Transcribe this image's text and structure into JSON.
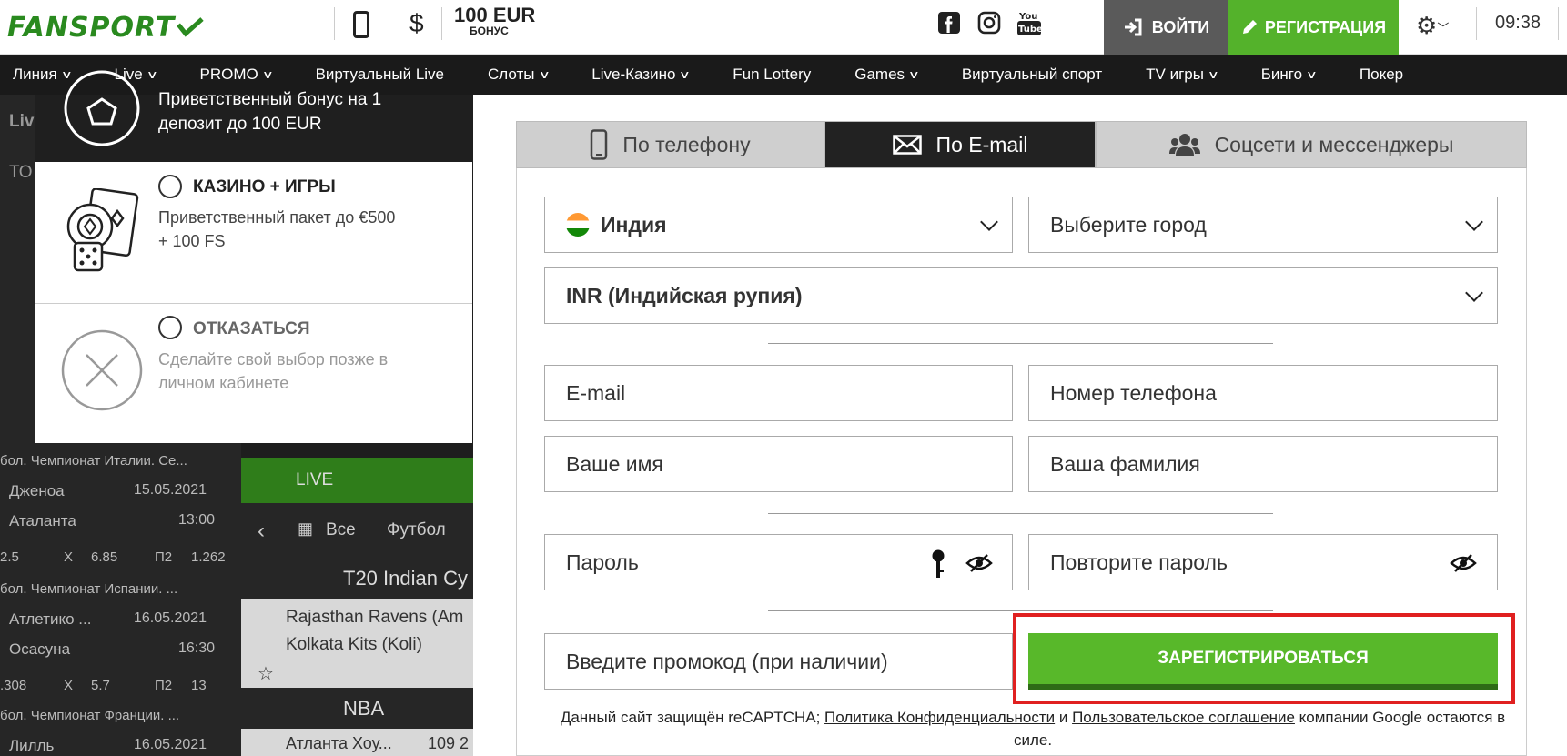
{
  "header": {
    "logo_main": "FANSPORT",
    "bonus_amount": "100 EUR",
    "bonus_label": "БОНУС",
    "login_label": "ВОЙТИ",
    "register_label": "РЕГИСТРАЦИЯ",
    "time": "09:38"
  },
  "nav": [
    "Линия",
    "Live",
    "PROMO",
    "Виртуальный Live",
    "Слоты",
    "Live-Казино",
    "Fun Lottery",
    "Games",
    "Виртуальный спорт",
    "TV игры",
    "Бинго",
    "Покер"
  ],
  "nav_dropdown": [
    true,
    true,
    true,
    false,
    true,
    true,
    false,
    true,
    false,
    true,
    true,
    false
  ],
  "background": {
    "live_label": "LIVE",
    "all_label": "Все",
    "football_label": "Футбол",
    "event1": "T20 Indian Cу",
    "event1_team1": "Rajasthan Ravens (Am",
    "event1_team2": "Kolkata Kits (Koli)",
    "event2": "NBA",
    "event2_team": "Атланта Хоу...",
    "event2_score": "109 2",
    "rows": [
      {
        "league": "бол. Чемпионат Италии. Се...",
        "team1": "Дженоа",
        "date": "15.05.2021",
        "team2": "Аталанта",
        "time": "13:00",
        "odds": [
          "2.5",
          "X",
          "6.85",
          "П2",
          "1.262"
        ]
      },
      {
        "league": "бол. Чемпионат Испании. ...",
        "team1": "Атлетико ...",
        "date": "16.05.2021",
        "team2": "Осасуна",
        "time": "16:30",
        "odds": [
          ".308",
          "X",
          "5.7",
          "П2",
          "13"
        ]
      },
      {
        "league": "бол. Чемпионат Франции. ...",
        "team1": "Лилль",
        "date": "16.05.2021"
      }
    ]
  },
  "bonus_panel": {
    "top_text_1": "Приветственный бонус на 1",
    "top_text_2": "депозит до 100 EUR",
    "casino_title": "КАЗИНО + ИГРЫ",
    "casino_desc_1": "Приветственный пакет до €500",
    "casino_desc_2": "+ 100 FS",
    "decline_title": "ОТКАЗАТЬСЯ",
    "decline_desc_1": "Сделайте свой выбор позже в",
    "decline_desc_2": "личном кабинете"
  },
  "tabs": {
    "phone": "По телефону",
    "email": "По E-mail",
    "social": "Соцсети и мессенджеры",
    "active": "email"
  },
  "form": {
    "country": "Индия",
    "city_placeholder": "Выберите город",
    "currency": "INR (Индийская рупия)",
    "email_placeholder": "E-mail",
    "phone_placeholder": "Номер телефона",
    "first_name_placeholder": "Ваше имя",
    "last_name_placeholder": "Ваша фамилия",
    "password_placeholder": "Пароль",
    "password_repeat_placeholder": "Повторите пароль",
    "promo_placeholder": "Введите промокод (при наличии)",
    "submit_label": "ЗАРЕГИСТРИРОВАТЬСЯ"
  },
  "recaptcha": {
    "prefix": "Данный сайт защищён reCAPTCHA; ",
    "privacy": "Политика Конфиденциальности",
    "and": " и ",
    "terms": "Пользовательское соглашение",
    "suffix": " компании Google остаются в силе."
  },
  "colors": {
    "brand_green": "#54b22b",
    "highlight_red": "#e02020",
    "dark": "#1a1a1a"
  }
}
